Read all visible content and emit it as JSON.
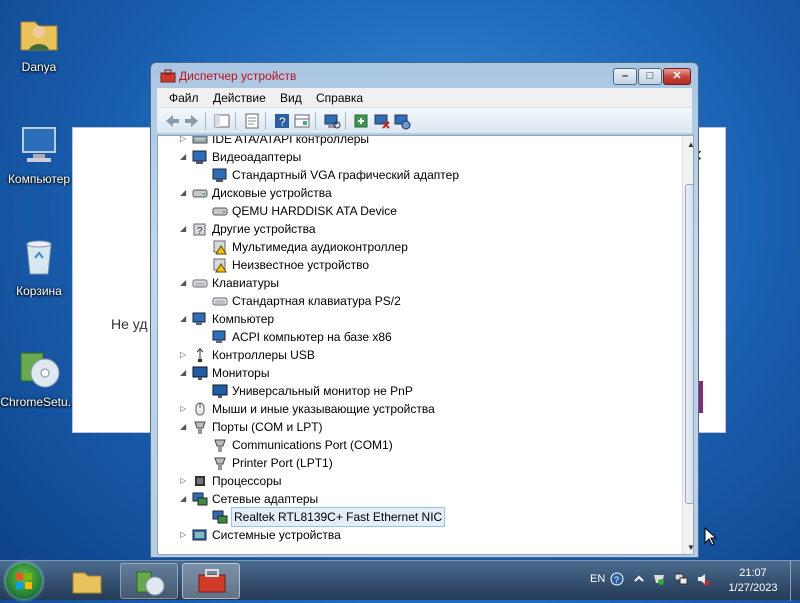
{
  "desktop": {
    "icons": [
      {
        "label": "Danya",
        "icon": "user-folder-icon"
      },
      {
        "label": "Компьютер",
        "icon": "computer-icon"
      },
      {
        "label": "Корзина",
        "icon": "recycle-bin-icon"
      },
      {
        "label": "ChromeSetu...",
        "icon": "setup-icon"
      }
    ]
  },
  "background_dialog": {
    "message": "Не уд"
  },
  "window": {
    "title": "Диспетчер устройств",
    "controls": {
      "minimize": "–",
      "maximize": "□",
      "close": "✕"
    },
    "menu": [
      "Файл",
      "Действие",
      "Вид",
      "Справка"
    ],
    "tree": [
      {
        "label": "IDE ATA/ATAPI контроллеры",
        "level": 0,
        "expanded": false,
        "icon": "ide-controller-icon"
      },
      {
        "label": "Видеоадаптеры",
        "level": 0,
        "expanded": true,
        "icon": "display-adapter-icon"
      },
      {
        "label": "Стандартный VGA графический адаптер",
        "level": 1,
        "icon": "display-adapter-icon"
      },
      {
        "label": "Дисковые устройства",
        "level": 0,
        "expanded": true,
        "icon": "disk-drive-icon"
      },
      {
        "label": "QEMU HARDDISK ATA Device",
        "level": 1,
        "icon": "disk-drive-icon"
      },
      {
        "label": "Другие устройства",
        "level": 0,
        "expanded": true,
        "icon": "unknown-device-icon"
      },
      {
        "label": "Мультимедиа аудиоконтроллер",
        "level": 1,
        "icon": "warning-device-icon"
      },
      {
        "label": "Неизвестное устройство",
        "level": 1,
        "icon": "warning-device-icon"
      },
      {
        "label": "Клавиатуры",
        "level": 0,
        "expanded": true,
        "icon": "keyboard-icon"
      },
      {
        "label": "Стандартная клавиатура PS/2",
        "level": 1,
        "icon": "keyboard-icon"
      },
      {
        "label": "Компьютер",
        "level": 0,
        "expanded": true,
        "icon": "computer-icon"
      },
      {
        "label": "ACPI компьютер на базе x86",
        "level": 1,
        "icon": "computer-icon"
      },
      {
        "label": "Контроллеры USB",
        "level": 0,
        "expanded": false,
        "icon": "usb-icon"
      },
      {
        "label": "Мониторы",
        "level": 0,
        "expanded": true,
        "icon": "monitor-icon"
      },
      {
        "label": "Универсальный монитор не PnP",
        "level": 1,
        "icon": "monitor-icon"
      },
      {
        "label": "Мыши и иные указывающие устройства",
        "level": 0,
        "expanded": false,
        "icon": "mouse-icon"
      },
      {
        "label": "Порты (COM и LPT)",
        "level": 0,
        "expanded": true,
        "icon": "port-icon"
      },
      {
        "label": "Communications Port (COM1)",
        "level": 1,
        "icon": "port-icon"
      },
      {
        "label": "Printer Port (LPT1)",
        "level": 1,
        "icon": "port-icon"
      },
      {
        "label": "Процессоры",
        "level": 0,
        "expanded": false,
        "icon": "processor-icon"
      },
      {
        "label": "Сетевые адаптеры",
        "level": 0,
        "expanded": true,
        "icon": "network-adapter-icon"
      },
      {
        "label": "Realtek RTL8139C+ Fast Ethernet NIC",
        "level": 1,
        "icon": "network-adapter-icon",
        "selected": true
      },
      {
        "label": "Системные устройства",
        "level": 0,
        "expanded": false,
        "icon": "system-device-icon"
      }
    ]
  },
  "taskbar": {
    "language": "EN",
    "time": "21:07",
    "date": "1/27/2023"
  }
}
